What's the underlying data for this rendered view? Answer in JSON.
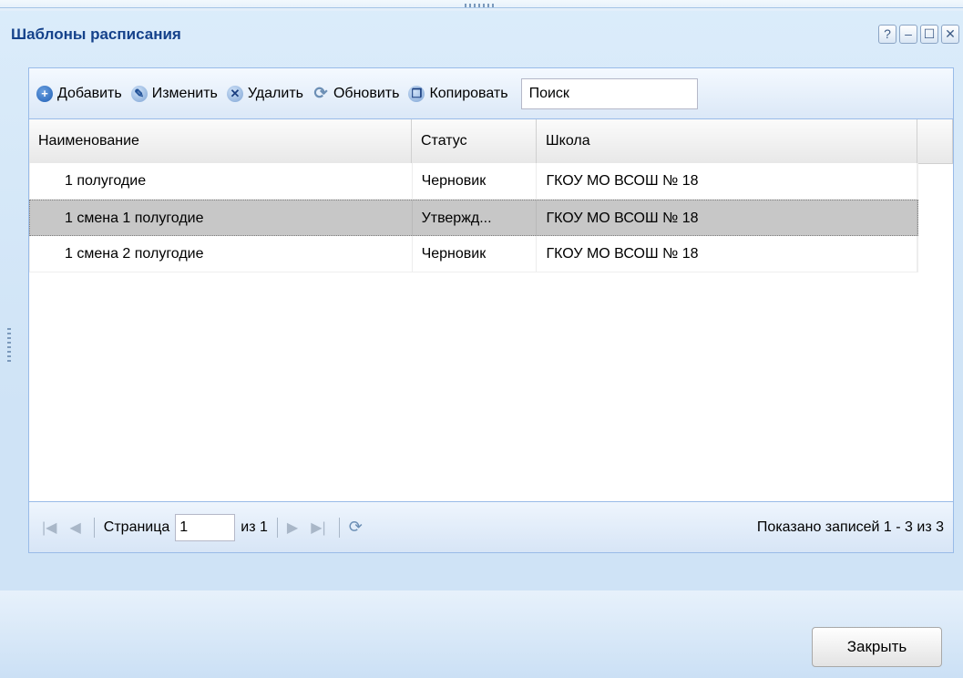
{
  "window": {
    "title": "Шаблоны расписания",
    "controls": [
      "?",
      "–",
      "☐",
      "✕"
    ]
  },
  "toolbar": {
    "add_label": "Добавить",
    "edit_label": "Изменить",
    "delete_label": "Удалить",
    "refresh_label": "Обновить",
    "copy_label": "Копировать",
    "search_value": "Поиск"
  },
  "grid": {
    "columns": [
      "Наименование",
      "Статус",
      "Школа",
      ""
    ],
    "rows": [
      {
        "name": "1 полугодие",
        "status": "Черновик",
        "school": "ГКОУ МО ВСОШ № 18",
        "selected": false
      },
      {
        "name": "1 смена 1 полугодие",
        "status": "Утвержд...",
        "school": "ГКОУ МО ВСОШ № 18",
        "selected": true
      },
      {
        "name": "1 смена 2 полугодие",
        "status": "Черновик",
        "school": "ГКОУ МО ВСОШ № 18",
        "selected": false
      }
    ]
  },
  "pager": {
    "page_label": "Страница",
    "page_value": "1",
    "of_label": "из 1",
    "info": "Показано записей 1 - 3 из 3"
  },
  "footer": {
    "close_label": "Закрыть"
  },
  "colors": {
    "title": "#15428b",
    "border": "#99bbe8",
    "selected_row": "#c7c7c7"
  }
}
